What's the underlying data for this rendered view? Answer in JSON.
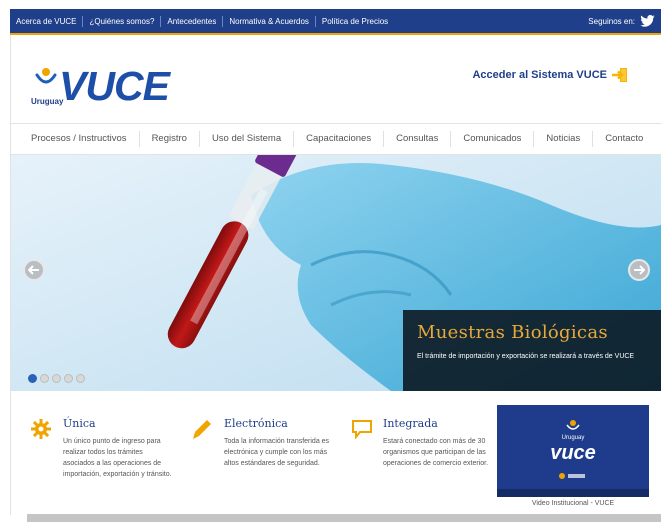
{
  "topbar": {
    "links": [
      "Acerca de VUCE",
      "¿Quiénes somos?",
      "Antecedentes",
      "Normativa & Acuerdos",
      "Política de Precios"
    ],
    "social_label": "Seguinos en:",
    "social_icon": "twitter-icon"
  },
  "header": {
    "logo_text": "VUCE",
    "logo_country": "Uruguay",
    "access_label": "Acceder al Sistema VUCE"
  },
  "nav": {
    "items": [
      "Procesos / Instructivos",
      "Registro",
      "Uso del Sistema",
      "Capacitaciones",
      "Consultas",
      "Comunicados",
      "Noticias",
      "Contacto"
    ]
  },
  "slider": {
    "caption_title": "Muestras Biológicas",
    "caption_text": "El trámite de importación y exportación se realizará a través de VUCE",
    "dot_count": 5,
    "active_dot": 0
  },
  "features": [
    {
      "icon": "gear-icon",
      "title": "Única",
      "text": "Un único punto de ingreso para realizar todos los trámites asociados a las operaciones de importación, exportación y tránsito."
    },
    {
      "icon": "pencil-icon",
      "title": "Electrónica",
      "text": "Toda la información transferida es electrónica y cumple con los más altos estándares de seguridad."
    },
    {
      "icon": "speech-bubble-icon",
      "title": "Integrada",
      "text": "Estará conectado con más de 30 organismos que participan de las operaciones de comercio exterior."
    }
  ],
  "video": {
    "logo_country": "Uruguay",
    "logo_text": "vuce",
    "caption": "Video Institucional - VUCE"
  },
  "colors": {
    "brand_blue": "#1f3f8a",
    "accent_orange": "#f0a400",
    "caption_title": "#e8a93a"
  }
}
